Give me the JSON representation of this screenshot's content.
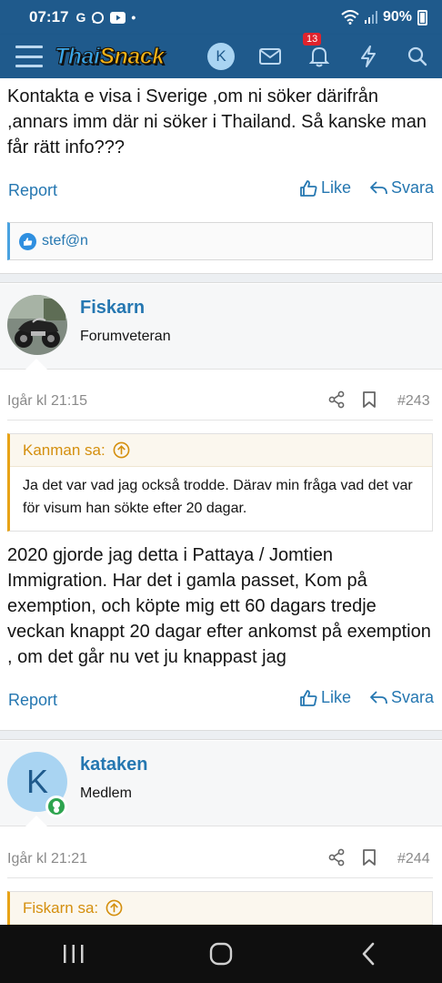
{
  "status_bar": {
    "time": "07:17",
    "battery": "90%"
  },
  "header": {
    "logo_part1": "Thai",
    "logo_part2": "Snack",
    "avatar_letter": "K",
    "notification_count": "13"
  },
  "posts": [
    {
      "text": "Kontakta e visa i Sverige ,om ni söker därifrån ,annars imm där ni söker i Thailand. Så kanske man får rätt info???",
      "report": "Report",
      "like": "Like",
      "reply": "Svara",
      "reactions": "stef@n"
    },
    {
      "author": "Fiskarn",
      "user_title": "Forumveteran",
      "date": "Igår kl 21:15",
      "number": "#243",
      "quote_author": "Kanman sa:",
      "quote_text": "Ja det var vad jag också trodde. Därav min fråga vad det var för visum han sökte efter 20 dagar.",
      "text": "2020 gjorde jag detta i Pattaya / Jomtien Immigration. Har det i gamla passet, Kom på exemption, och köpte mig ett 60 dagars tredje veckan knappt 20 dagar efter ankomst på exemption , om det går nu vet ju knappast jag",
      "report": "Report",
      "like": "Like",
      "reply": "Svara"
    },
    {
      "author": "kataken",
      "avatar_letter": "K",
      "user_title": "Medlem",
      "date": "Igår kl 21:21",
      "number": "#244",
      "quote_author": "Fiskarn sa:"
    }
  ],
  "colors": {
    "header_bg": "#1f5a8c",
    "link": "#2577b1",
    "quote_accent": "#e8a317",
    "online": "#2ea44f"
  }
}
